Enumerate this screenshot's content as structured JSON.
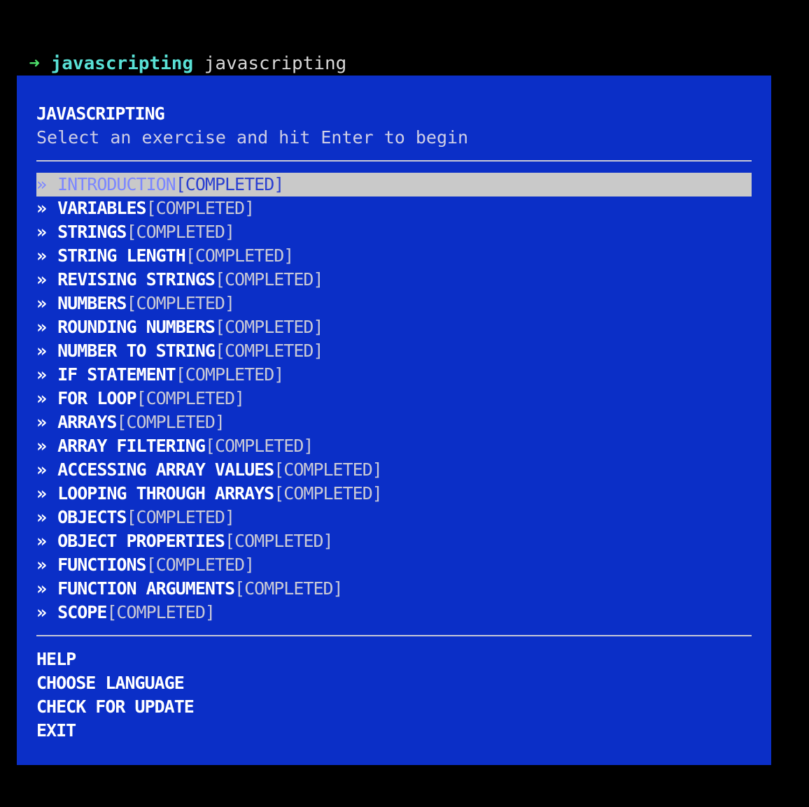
{
  "terminal": {
    "prompt_arrow": "➜",
    "cwd": "javascripting",
    "command": "javascripting"
  },
  "menu": {
    "title": "JAVASCRIPTING",
    "subtitle": "Select an exercise and hit Enter to begin",
    "bullet": "» ",
    "status_label": "[COMPLETED]",
    "selected_index": 0,
    "exercises": [
      {
        "name": "INTRODUCTION",
        "status": "[COMPLETED]"
      },
      {
        "name": "VARIABLES",
        "status": "[COMPLETED]"
      },
      {
        "name": "STRINGS",
        "status": "[COMPLETED]"
      },
      {
        "name": "STRING LENGTH",
        "status": "[COMPLETED]"
      },
      {
        "name": "REVISING STRINGS",
        "status": "[COMPLETED]"
      },
      {
        "name": "NUMBERS",
        "status": "[COMPLETED]"
      },
      {
        "name": "ROUNDING NUMBERS",
        "status": "[COMPLETED]"
      },
      {
        "name": "NUMBER TO STRING",
        "status": "[COMPLETED]"
      },
      {
        "name": "IF STATEMENT",
        "status": "[COMPLETED]"
      },
      {
        "name": "FOR LOOP",
        "status": "[COMPLETED]"
      },
      {
        "name": "ARRAYS",
        "status": "[COMPLETED]"
      },
      {
        "name": "ARRAY FILTERING",
        "status": "[COMPLETED]"
      },
      {
        "name": "ACCESSING ARRAY VALUES",
        "status": "[COMPLETED]"
      },
      {
        "name": "LOOPING THROUGH ARRAYS",
        "status": "[COMPLETED]"
      },
      {
        "name": "OBJECTS",
        "status": "[COMPLETED]"
      },
      {
        "name": "OBJECT PROPERTIES",
        "status": "[COMPLETED]"
      },
      {
        "name": "FUNCTIONS",
        "status": "[COMPLETED]"
      },
      {
        "name": "FUNCTION ARGUMENTS",
        "status": "[COMPLETED]"
      },
      {
        "name": "SCOPE",
        "status": "[COMPLETED]"
      }
    ],
    "footer": [
      "HELP",
      "CHOOSE LANGUAGE",
      "CHECK FOR UPDATE",
      "EXIT"
    ]
  },
  "colors": {
    "background": "#000000",
    "menu_background": "#0b2fc7",
    "selected_background": "#c9c9c9",
    "prompt_arrow": "#4ee06b",
    "prompt_cwd": "#59e1d6"
  }
}
